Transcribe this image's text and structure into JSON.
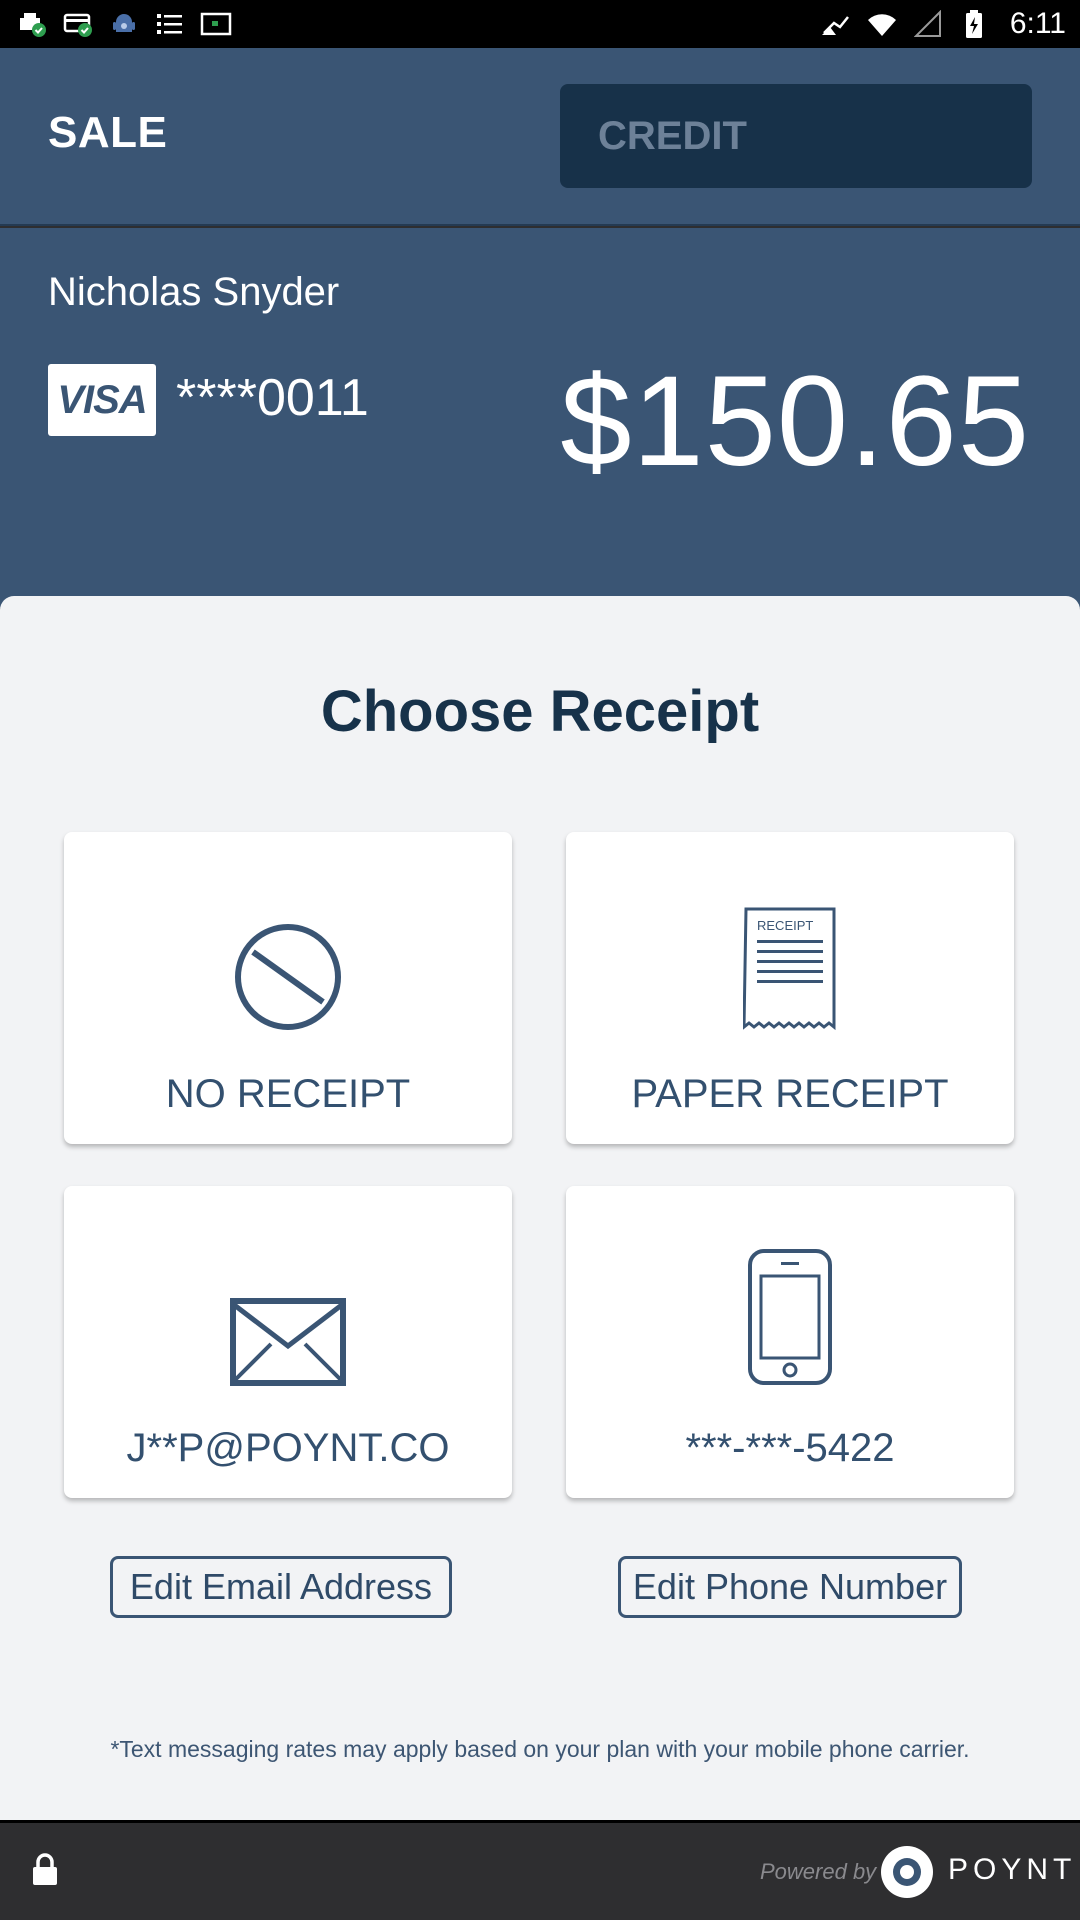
{
  "status_bar": {
    "time": "6:11",
    "left_icons": [
      "printer-check-icon",
      "card-check-icon",
      "android-debug-icon",
      "list-icon",
      "screen-icon"
    ],
    "right_icons": [
      "hotspot-icon",
      "wifi-icon",
      "signal-icon",
      "battery-charging-icon"
    ]
  },
  "header": {
    "title": "SALE",
    "payment_type": "CREDIT"
  },
  "transaction": {
    "customer_name": "Nicholas Snyder",
    "card_brand": "VISA",
    "card_number": "****0011",
    "amount": "$150.65"
  },
  "receipt": {
    "title": "Choose Receipt",
    "options": {
      "no_receipt": "NO RECEIPT",
      "paper_receipt": "PAPER RECEIPT",
      "paper_receipt_icon_text": "RECEIPT",
      "email": "J**P@POYNT.CO",
      "phone": "***-***-5422"
    },
    "edit_email_label": "Edit Email Address",
    "edit_phone_label": "Edit Phone Number",
    "disclaimer": "*Text messaging rates may apply based on your plan with your mobile  phone carrier."
  },
  "footer": {
    "powered_by": "Powered by",
    "brand": "POYNT"
  },
  "colors": {
    "header_bg": "#3a5574",
    "credit_bg": "#173149",
    "panel_bg": "#f2f3f5",
    "accent_text": "#33506f",
    "footer_bg": "#2e2e30"
  }
}
